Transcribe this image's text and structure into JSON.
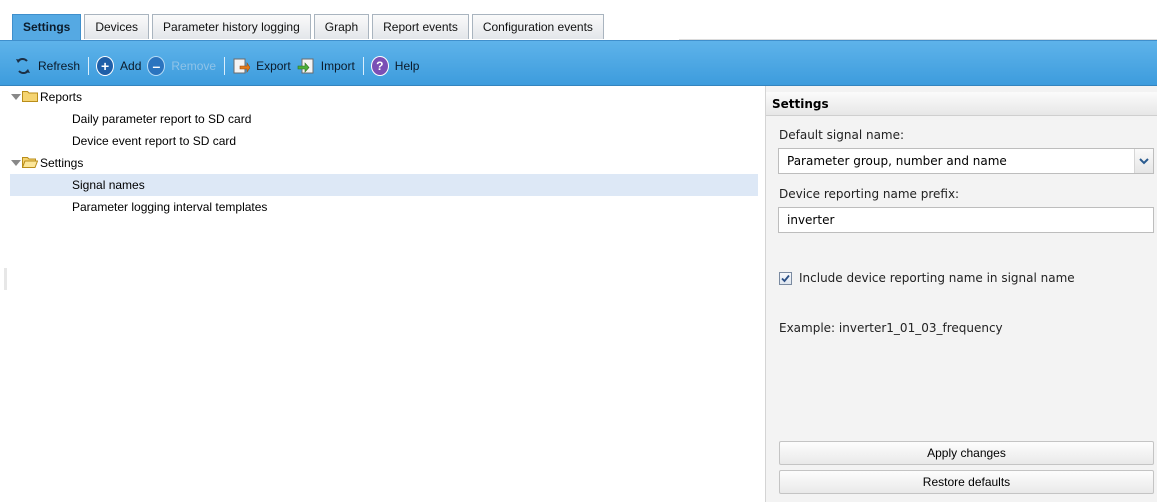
{
  "tabs": [
    {
      "label": "Settings",
      "active": true
    },
    {
      "label": "Devices",
      "active": false
    },
    {
      "label": "Parameter history logging",
      "active": false
    },
    {
      "label": "Graph",
      "active": false
    },
    {
      "label": "Report events",
      "active": false
    },
    {
      "label": "Configuration events",
      "active": false
    }
  ],
  "toolbar": {
    "refresh_label": "Refresh",
    "add_label": "Add",
    "remove_label": "Remove",
    "export_label": "Export",
    "import_label": "Import",
    "help_label": "Help",
    "remove_disabled": true
  },
  "tree": {
    "reports": {
      "label": "Reports",
      "children": [
        "Daily parameter report to SD card",
        "Device event report to SD card"
      ]
    },
    "settings": {
      "label": "Settings",
      "children": [
        "Signal names",
        "Parameter logging interval templates"
      ],
      "selected_child": "Signal names"
    }
  },
  "panel": {
    "header": "Settings",
    "default_signal_name_label": "Default signal name:",
    "default_signal_name_value": "Parameter group, number and name",
    "prefix_label": "Device reporting name prefix:",
    "prefix_value": "inverter",
    "include_checkbox_label": "Include device reporting name in signal name",
    "include_checked": true,
    "example_text": "Example: inverter1_01_03_frequency",
    "apply_button": "Apply changes",
    "restore_button": "Restore defaults"
  },
  "colors": {
    "toolbar": "#4aa6e2",
    "active_tab": "#55a9e3",
    "selected_row": "#dde8f6",
    "panel_bg": "#f3f3f3"
  },
  "icons": [
    "refresh-icon",
    "add-icon",
    "remove-icon",
    "export-icon",
    "import-icon",
    "help-icon",
    "folder-icon",
    "expander-icon",
    "dropdown-arrow-icon",
    "checkbox-icon"
  ]
}
